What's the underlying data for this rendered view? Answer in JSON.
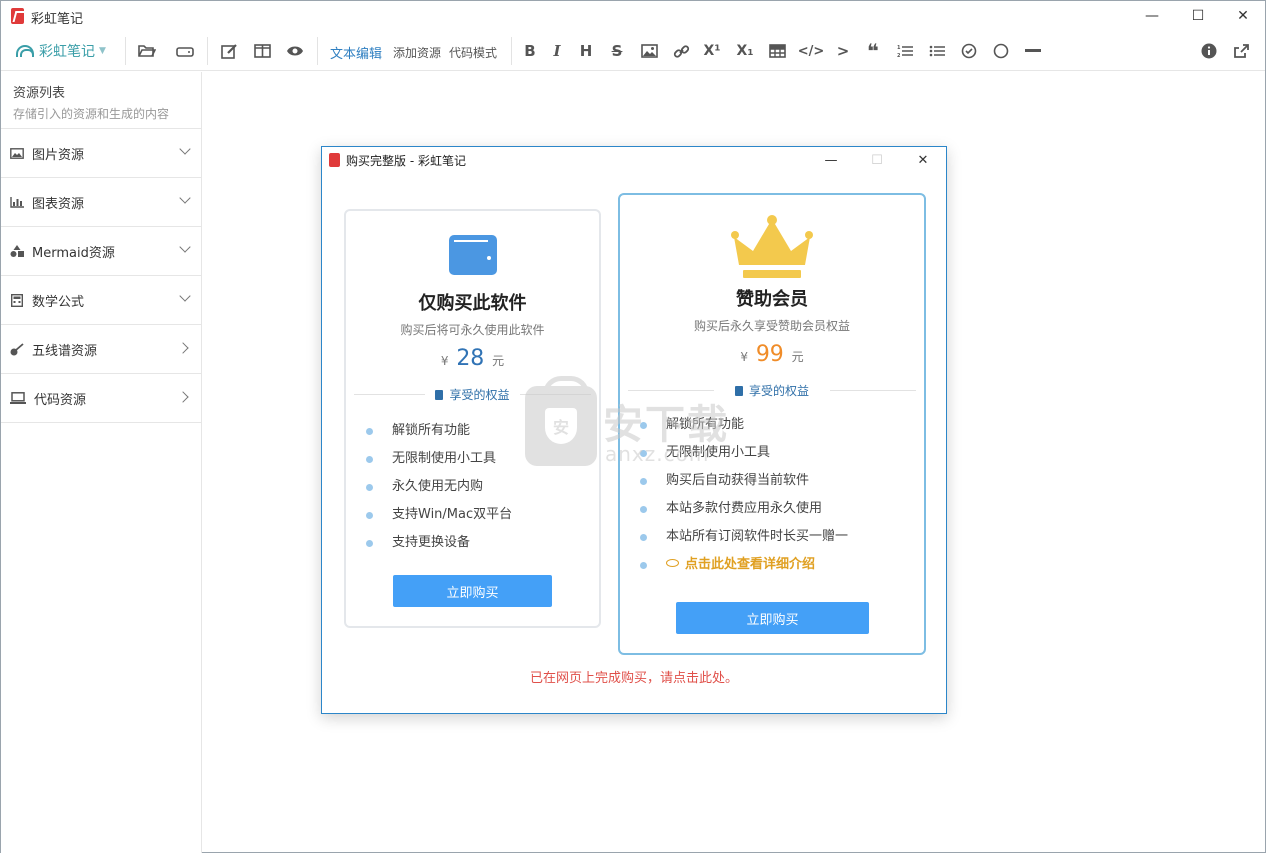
{
  "window": {
    "title": "彩虹笔记",
    "controls": {
      "minimize": "—",
      "maximize": "☐",
      "close": "✕"
    }
  },
  "toolbar": {
    "brand_label": "彩虹笔记",
    "mode_tabs": [
      "文本编辑",
      "添加资源",
      "代码模式"
    ],
    "format_icons": [
      "B",
      "I",
      "H",
      "S",
      "▣",
      "⊘",
      "X¹",
      "X₁",
      "⊞",
      "</>",
      ">",
      "❝",
      "≡",
      "☰",
      "✓",
      "○",
      "—"
    ],
    "right_icons": {
      "info": "i",
      "share": "↗"
    }
  },
  "sidebar": {
    "title": "资源列表",
    "subtitle": "存储引入的资源和生成的内容",
    "items": [
      {
        "label": "图片资源",
        "icon": "image-icon",
        "expanded": true
      },
      {
        "label": "图表资源",
        "icon": "bar-chart-icon",
        "expanded": true
      },
      {
        "label": "Mermaid资源",
        "icon": "shapes-icon",
        "expanded": true
      },
      {
        "label": "数学公式",
        "icon": "calculator-icon",
        "expanded": true
      },
      {
        "label": "五线谱资源",
        "icon": "guitar-icon",
        "expanded": false
      },
      {
        "label": "代码资源",
        "icon": "laptop-icon",
        "expanded": false
      }
    ]
  },
  "dialog": {
    "title": "购买完整版 - 彩虹笔记",
    "controls": {
      "minimize": "—",
      "maximize": "☐",
      "close": "✕"
    },
    "basic": {
      "name": "仅购买此软件",
      "desc": "购买后将可永久使用此软件",
      "currency": "¥",
      "price": "28",
      "unit": "元",
      "perks_title": "享受的权益",
      "perks": [
        "解锁所有功能",
        "无限制使用小工具",
        "永久使用无内购",
        "支持Win/Mac双平台",
        "支持更换设备"
      ],
      "buy_label": "立即购买"
    },
    "vip": {
      "name": "赞助会员",
      "desc": "购买后永久享受赞助会员权益",
      "currency": "¥",
      "price": "99",
      "unit": "元",
      "perks_title": "享受的权益",
      "perks": [
        "解锁所有功能",
        "无限制使用小工具",
        "购买后自动获得当前软件",
        "本站多款付费应用永久使用",
        "本站所有订阅软件时长买一赠一"
      ],
      "detail_link": "点击此处查看详细介绍",
      "buy_label": "立即购买"
    },
    "done_link": "已在网页上完成购买，请点击此处。"
  },
  "watermark": {
    "text": "安下载",
    "sub": "anxz.com",
    "badge": "安"
  },
  "colors": {
    "accent": "#44a0f7",
    "brand": "#3a9ea8",
    "price_basic": "#3073b5",
    "price_vip": "#f08c28",
    "link_red": "#e0504a",
    "gold": "#e0a022"
  }
}
